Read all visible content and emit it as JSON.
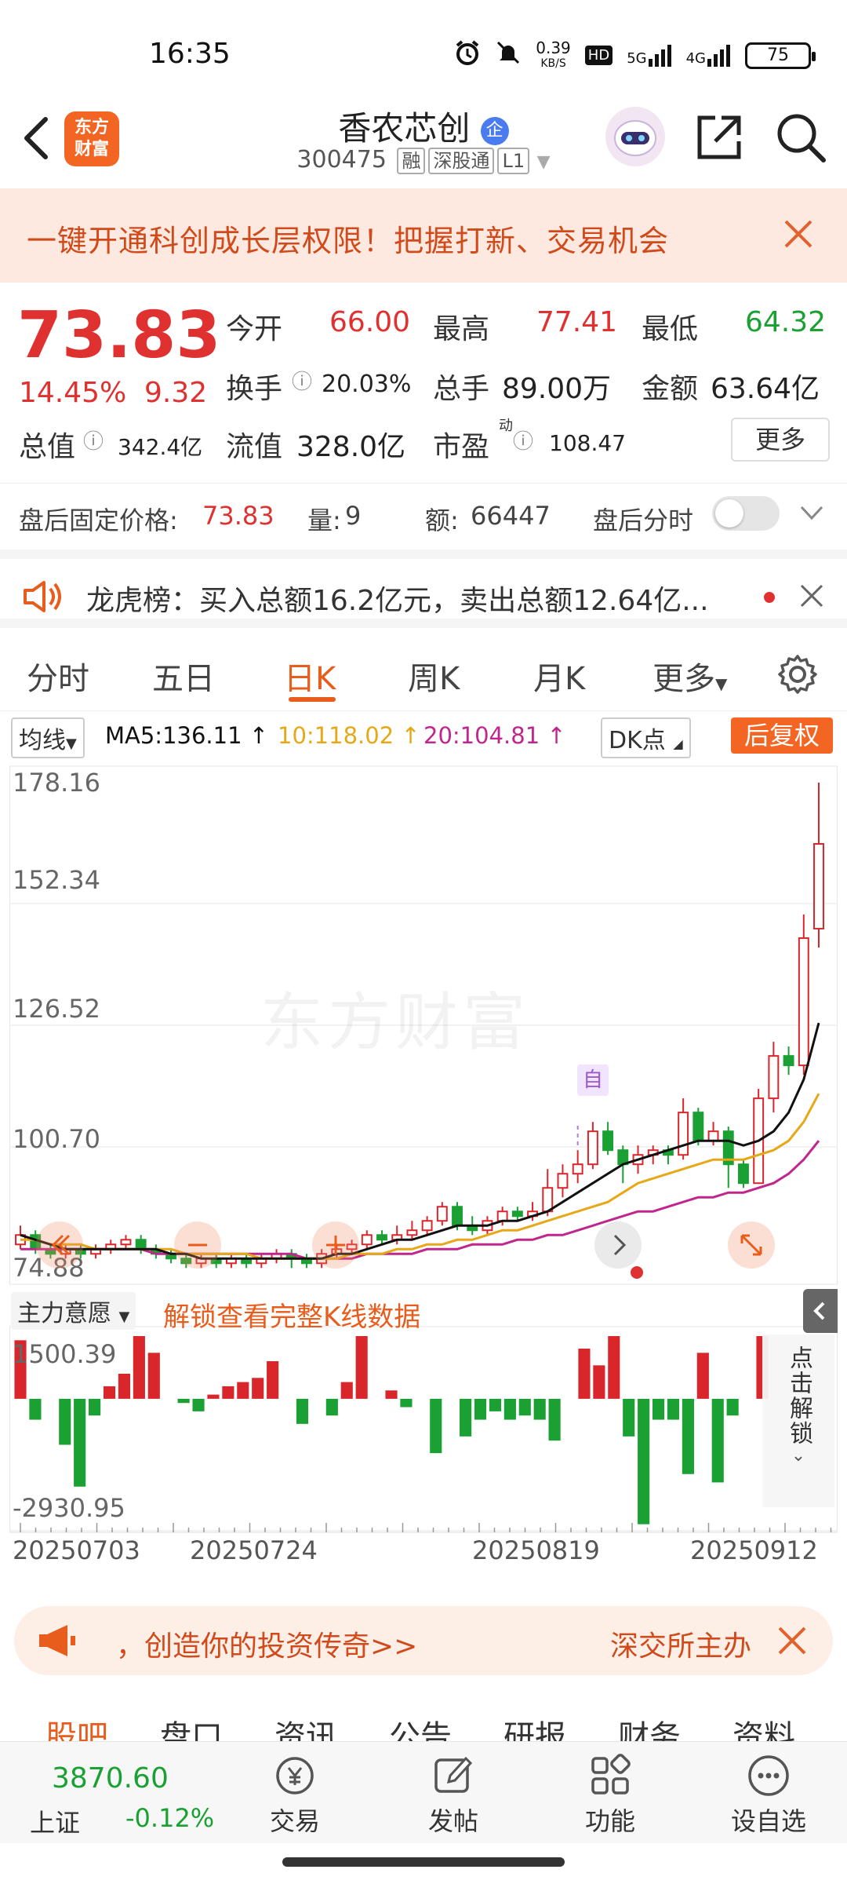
{
  "status": {
    "time": "16:35",
    "net_speed_top": "0.39",
    "net_speed_unit": "KB/S",
    "hd": "HD",
    "signal1": "5G",
    "signal2": "4G",
    "battery": "75"
  },
  "header": {
    "logo_line1": "东方",
    "logo_line2": "财富",
    "stock_name": "香农芯创",
    "stock_badge": "企",
    "stock_code": "300475",
    "tags": [
      "融",
      "深股通",
      "L1"
    ]
  },
  "banner": {
    "text": "一键开通科创成长层权限！把握打新、交易机会"
  },
  "quote": {
    "price": "73.83",
    "change_pct": "14.45%",
    "change_amt": "9.32",
    "open_label": "今开",
    "open_val": "66.00",
    "high_label": "最高",
    "high_val": "77.41",
    "low_label": "最低",
    "low_val": "64.32",
    "turnover_label": "换手",
    "turnover_val": "20.03%",
    "volume_label": "总手",
    "volume_val": "89.00万",
    "amount_label": "金额",
    "amount_val": "63.64亿",
    "mcap_label": "总值",
    "mcap_val": "342.4亿",
    "float_label": "流值",
    "float_val": "328.0亿",
    "pe_label": "市盈",
    "pe_sup": "动",
    "pe_val": "108.47",
    "more_label": "更多"
  },
  "after_hours": {
    "price_label": "盘后固定价格:",
    "price_val": "73.83",
    "vol_label": "量:",
    "vol_val": "9",
    "amt_label": "额:",
    "amt_val": "66447",
    "intraday_label": "盘后分时"
  },
  "lhb": {
    "text": "龙虎榜：买入总额16.2亿元，卖出总额12.64亿..."
  },
  "ktabs": [
    "分时",
    "五日",
    "日K",
    "周K",
    "月K",
    "更多"
  ],
  "ma": {
    "selector": "均线",
    "ma5": "MA5:136.11",
    "ma10": "10:118.02",
    "ma20": "20:104.81",
    "dk": "DK点",
    "adjust": "后复权",
    "colors": {
      "ma5": "#111111",
      "ma10": "#e6a817",
      "ma20": "#c0268c",
      "up": "#d9262b",
      "down": "#1aa033"
    }
  },
  "chart_data": [
    {
      "type": "candlestick",
      "title": "",
      "y_ticks": [
        "178.16",
        "152.34",
        "126.52",
        "100.70",
        "74.88"
      ],
      "ylim": [
        74.88,
        178.16
      ],
      "x_ticks": [
        "20250703",
        "20250724",
        "20250819",
        "20250912"
      ],
      "watermark": "东方财富",
      "marker": "自",
      "candles": [
        {
          "o": 80,
          "c": 82,
          "h": 84,
          "l": 79
        },
        {
          "o": 82,
          "c": 79,
          "h": 83,
          "l": 78
        },
        {
          "o": 79,
          "c": 78,
          "h": 80,
          "l": 77
        },
        {
          "o": 78,
          "c": 79,
          "h": 80,
          "l": 77
        },
        {
          "o": 79,
          "c": 78,
          "h": 80,
          "l": 77
        },
        {
          "o": 78,
          "c": 79,
          "h": 80,
          "l": 77
        },
        {
          "o": 79,
          "c": 80,
          "h": 81,
          "l": 78
        },
        {
          "o": 80,
          "c": 81,
          "h": 82,
          "l": 79
        },
        {
          "o": 81,
          "c": 79,
          "h": 82,
          "l": 78
        },
        {
          "o": 79,
          "c": 78,
          "h": 80,
          "l": 77
        },
        {
          "o": 78,
          "c": 77,
          "h": 79,
          "l": 76
        },
        {
          "o": 77,
          "c": 76,
          "h": 78,
          "l": 75
        },
        {
          "o": 76,
          "c": 77,
          "h": 78,
          "l": 75
        },
        {
          "o": 77,
          "c": 76,
          "h": 78,
          "l": 75
        },
        {
          "o": 76,
          "c": 77,
          "h": 78,
          "l": 75
        },
        {
          "o": 77,
          "c": 76,
          "h": 78,
          "l": 75
        },
        {
          "o": 76,
          "c": 77,
          "h": 78,
          "l": 75
        },
        {
          "o": 77,
          "c": 78,
          "h": 79,
          "l": 76
        },
        {
          "o": 78,
          "c": 77,
          "h": 79,
          "l": 75
        },
        {
          "o": 77,
          "c": 76,
          "h": 78,
          "l": 75
        },
        {
          "o": 76,
          "c": 78,
          "h": 79,
          "l": 75
        },
        {
          "o": 78,
          "c": 79,
          "h": 80,
          "l": 77
        },
        {
          "o": 79,
          "c": 80,
          "h": 81,
          "l": 78
        },
        {
          "o": 80,
          "c": 82,
          "h": 83,
          "l": 79
        },
        {
          "o": 82,
          "c": 81,
          "h": 83,
          "l": 80
        },
        {
          "o": 81,
          "c": 82,
          "h": 84,
          "l": 80
        },
        {
          "o": 82,
          "c": 83,
          "h": 85,
          "l": 81
        },
        {
          "o": 83,
          "c": 85,
          "h": 86,
          "l": 82
        },
        {
          "o": 85,
          "c": 88,
          "h": 89,
          "l": 84
        },
        {
          "o": 88,
          "c": 84,
          "h": 89,
          "l": 83
        },
        {
          "o": 84,
          "c": 83,
          "h": 86,
          "l": 82
        },
        {
          "o": 83,
          "c": 85,
          "h": 86,
          "l": 82
        },
        {
          "o": 85,
          "c": 87,
          "h": 88,
          "l": 84
        },
        {
          "o": 87,
          "c": 86,
          "h": 88,
          "l": 85
        },
        {
          "o": 86,
          "c": 87,
          "h": 89,
          "l": 85
        },
        {
          "o": 87,
          "c": 92,
          "h": 96,
          "l": 86
        },
        {
          "o": 92,
          "c": 95,
          "h": 97,
          "l": 90
        },
        {
          "o": 95,
          "c": 97,
          "h": 100,
          "l": 93
        },
        {
          "o": 97,
          "c": 104,
          "h": 106,
          "l": 96
        },
        {
          "o": 104,
          "c": 100,
          "h": 106,
          "l": 99
        },
        {
          "o": 100,
          "c": 97,
          "h": 101,
          "l": 93
        },
        {
          "o": 97,
          "c": 99,
          "h": 101,
          "l": 95
        },
        {
          "o": 99,
          "c": 100,
          "h": 101,
          "l": 97
        },
        {
          "o": 100,
          "c": 99,
          "h": 101,
          "l": 97
        },
        {
          "o": 99,
          "c": 108,
          "h": 111,
          "l": 98
        },
        {
          "o": 108,
          "c": 102,
          "h": 109,
          "l": 101
        },
        {
          "o": 102,
          "c": 104,
          "h": 106,
          "l": 101
        },
        {
          "o": 104,
          "c": 97,
          "h": 105,
          "l": 92
        },
        {
          "o": 97,
          "c": 93,
          "h": 98,
          "l": 92
        },
        {
          "o": 93,
          "c": 111,
          "h": 113,
          "l": 93
        },
        {
          "o": 111,
          "c": 120,
          "h": 123,
          "l": 108
        },
        {
          "o": 120,
          "c": 118,
          "h": 122,
          "l": 116
        },
        {
          "o": 118,
          "c": 145,
          "h": 150,
          "l": 116
        },
        {
          "o": 147,
          "c": 165,
          "h": 178,
          "l": 143
        }
      ],
      "ma5": [
        82,
        81,
        80,
        79,
        79,
        79,
        79,
        79,
        79,
        79,
        78,
        78,
        77,
        77,
        77,
        77,
        77,
        77,
        77,
        77,
        77,
        78,
        78,
        79,
        80,
        81,
        81,
        82,
        83,
        84,
        84,
        84,
        85,
        85,
        86,
        87,
        89,
        91,
        93,
        95,
        97,
        98,
        99,
        100,
        101,
        102,
        102,
        102,
        101,
        102,
        104,
        108,
        115,
        127
      ],
      "ma10": [
        81,
        81,
        80,
        80,
        80,
        79,
        79,
        79,
        79,
        79,
        79,
        78,
        78,
        78,
        78,
        78,
        77,
        77,
        77,
        77,
        77,
        77,
        78,
        78,
        78,
        79,
        79,
        80,
        80,
        81,
        81,
        82,
        83,
        83,
        84,
        85,
        86,
        87,
        88,
        89,
        91,
        93,
        94,
        95,
        96,
        97,
        98,
        98,
        98,
        99,
        100,
        102,
        106,
        112
      ],
      "ma20": [
        79,
        79,
        79,
        79,
        79,
        79,
        79,
        79,
        79,
        78,
        78,
        78,
        78,
        78,
        78,
        78,
        78,
        78,
        78,
        77,
        77,
        77,
        77,
        78,
        78,
        78,
        78,
        79,
        79,
        79,
        80,
        80,
        80,
        81,
        81,
        82,
        82,
        83,
        84,
        85,
        86,
        87,
        87,
        88,
        89,
        90,
        90,
        91,
        91,
        92,
        93,
        95,
        98,
        102
      ]
    },
    {
      "type": "bar",
      "title": "主力意愿",
      "y_ticks": [
        "1500.39",
        "-2930.95"
      ],
      "ylim": [
        -2930.95,
        1500.39
      ],
      "values": [
        1400,
        -500,
        0,
        -1100,
        -2100,
        -400,
        300,
        600,
        1500,
        1100,
        0,
        -100,
        -300,
        100,
        300,
        400,
        500,
        900,
        0,
        -600,
        0,
        -400,
        400,
        1500,
        0,
        200,
        -200,
        0,
        -1300,
        0,
        -900,
        -500,
        -300,
        -500,
        -400,
        -500,
        -1000,
        0,
        1200,
        800,
        1500,
        -900,
        -3000,
        -500,
        -500,
        -1800,
        1100,
        -2000,
        -400,
        0,
        1500
      ],
      "unlock_text": "解锁查看完整K线数据",
      "side_text": "点击解锁"
    }
  ],
  "promo": {
    "text": "，创造你的投资传奇>>",
    "right_text": "深交所主办"
  },
  "bottom_tabs": [
    "股吧",
    "盘口",
    "资讯",
    "公告",
    "研报",
    "财务",
    "资料"
  ],
  "bottom_nav": {
    "index_val": "3870.60",
    "index_name": "上证",
    "index_chg": "-0.12%",
    "items": [
      "交易",
      "发帖",
      "功能",
      "设自选"
    ]
  }
}
